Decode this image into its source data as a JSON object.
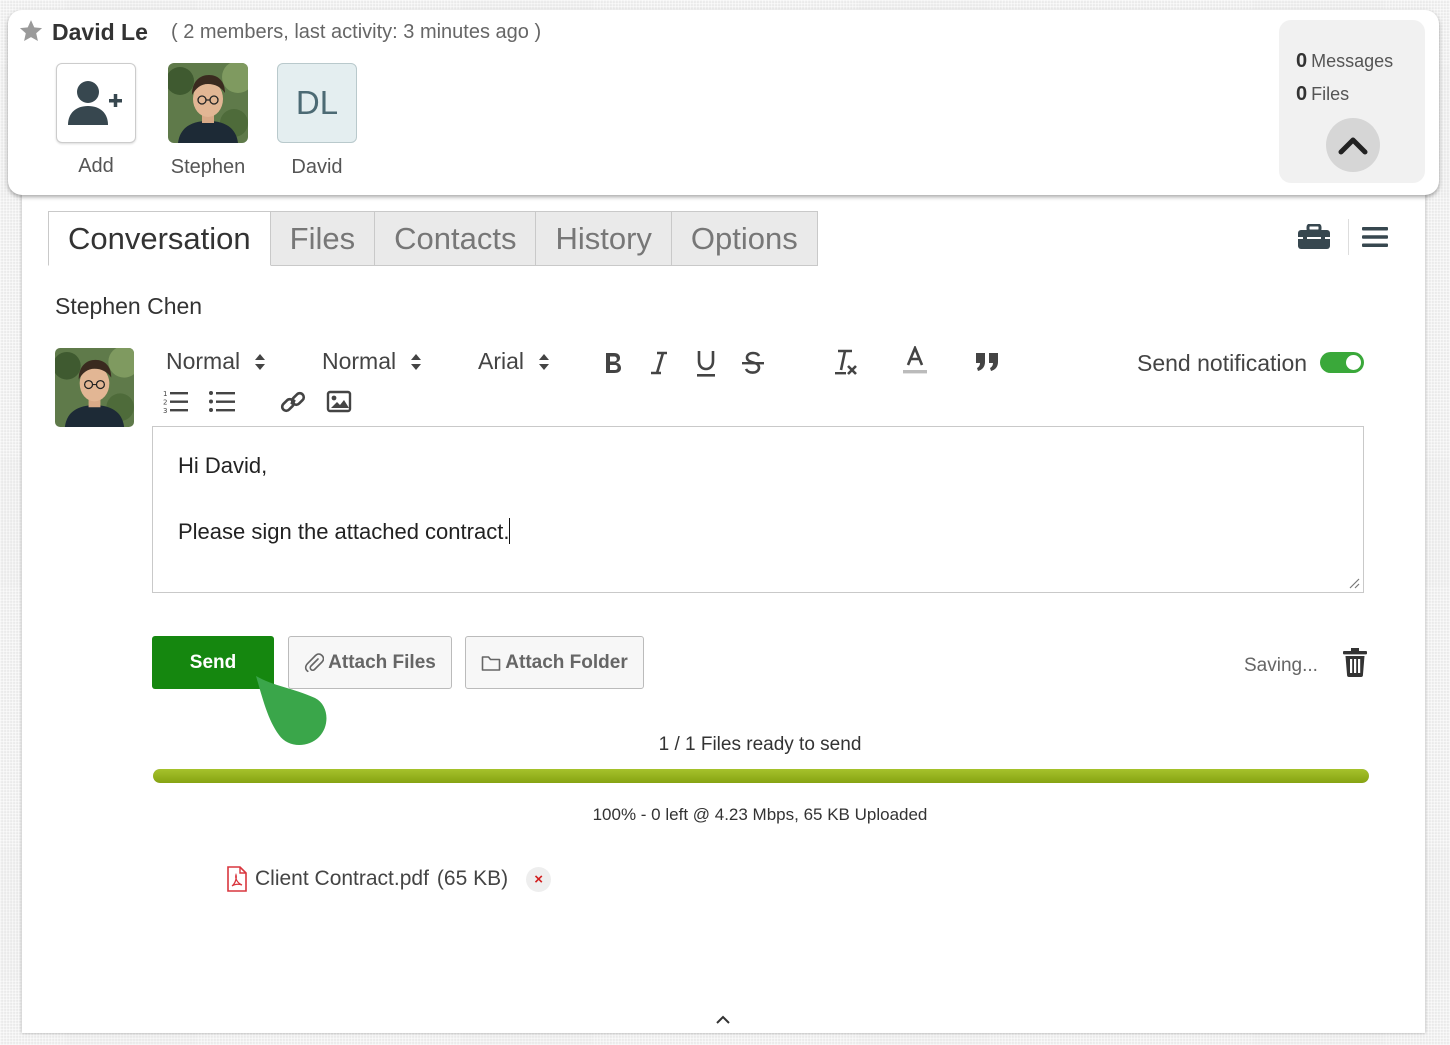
{
  "header": {
    "group_name": "David Le",
    "group_meta": "( 2 members, last activity: 3 minutes ago )",
    "members": [
      {
        "label": "Add",
        "icon": "add-user-icon"
      },
      {
        "label": "Stephen"
      },
      {
        "label": "David",
        "initials": "DL"
      }
    ],
    "stats": {
      "messages_count": "0",
      "messages_label": "Messages",
      "files_count": "0",
      "files_label": "Files"
    }
  },
  "tabs": [
    "Conversation",
    "Files",
    "Contacts",
    "History",
    "Options"
  ],
  "active_tab": "Conversation",
  "composer": {
    "author": "Stephen Chen",
    "toolbar": {
      "header_select": "Normal",
      "size_select": "Normal",
      "font_select": "Arial",
      "icons": [
        "bold-icon",
        "italic-icon",
        "underline-icon",
        "strike-icon",
        "clear-format-icon",
        "text-color-icon",
        "quote-icon",
        "ordered-list-icon",
        "bullet-list-icon",
        "link-icon",
        "image-icon"
      ]
    },
    "notify_label": "Send notification",
    "notify_on": true,
    "body_line1": "Hi David,",
    "body_line2": "Please sign the attached contract."
  },
  "actions": {
    "send": "Send",
    "attach_files": "Attach Files",
    "attach_folder": "Attach Folder",
    "saving": "Saving..."
  },
  "upload": {
    "ready_text": "1 / 1 Files ready to send",
    "progress_percent": 100,
    "stats_text": "100% - 0 left @ 4.23 Mbps, 65 KB Uploaded",
    "file_name": "Client Contract.pdf",
    "file_size": "(65 KB)",
    "remove_glyph": "×"
  },
  "colors": {
    "send_green": "#15870f",
    "toggle_green": "#3aa83a",
    "progress_green": "#8fae1b",
    "pointer_green": "#3aa64a"
  }
}
